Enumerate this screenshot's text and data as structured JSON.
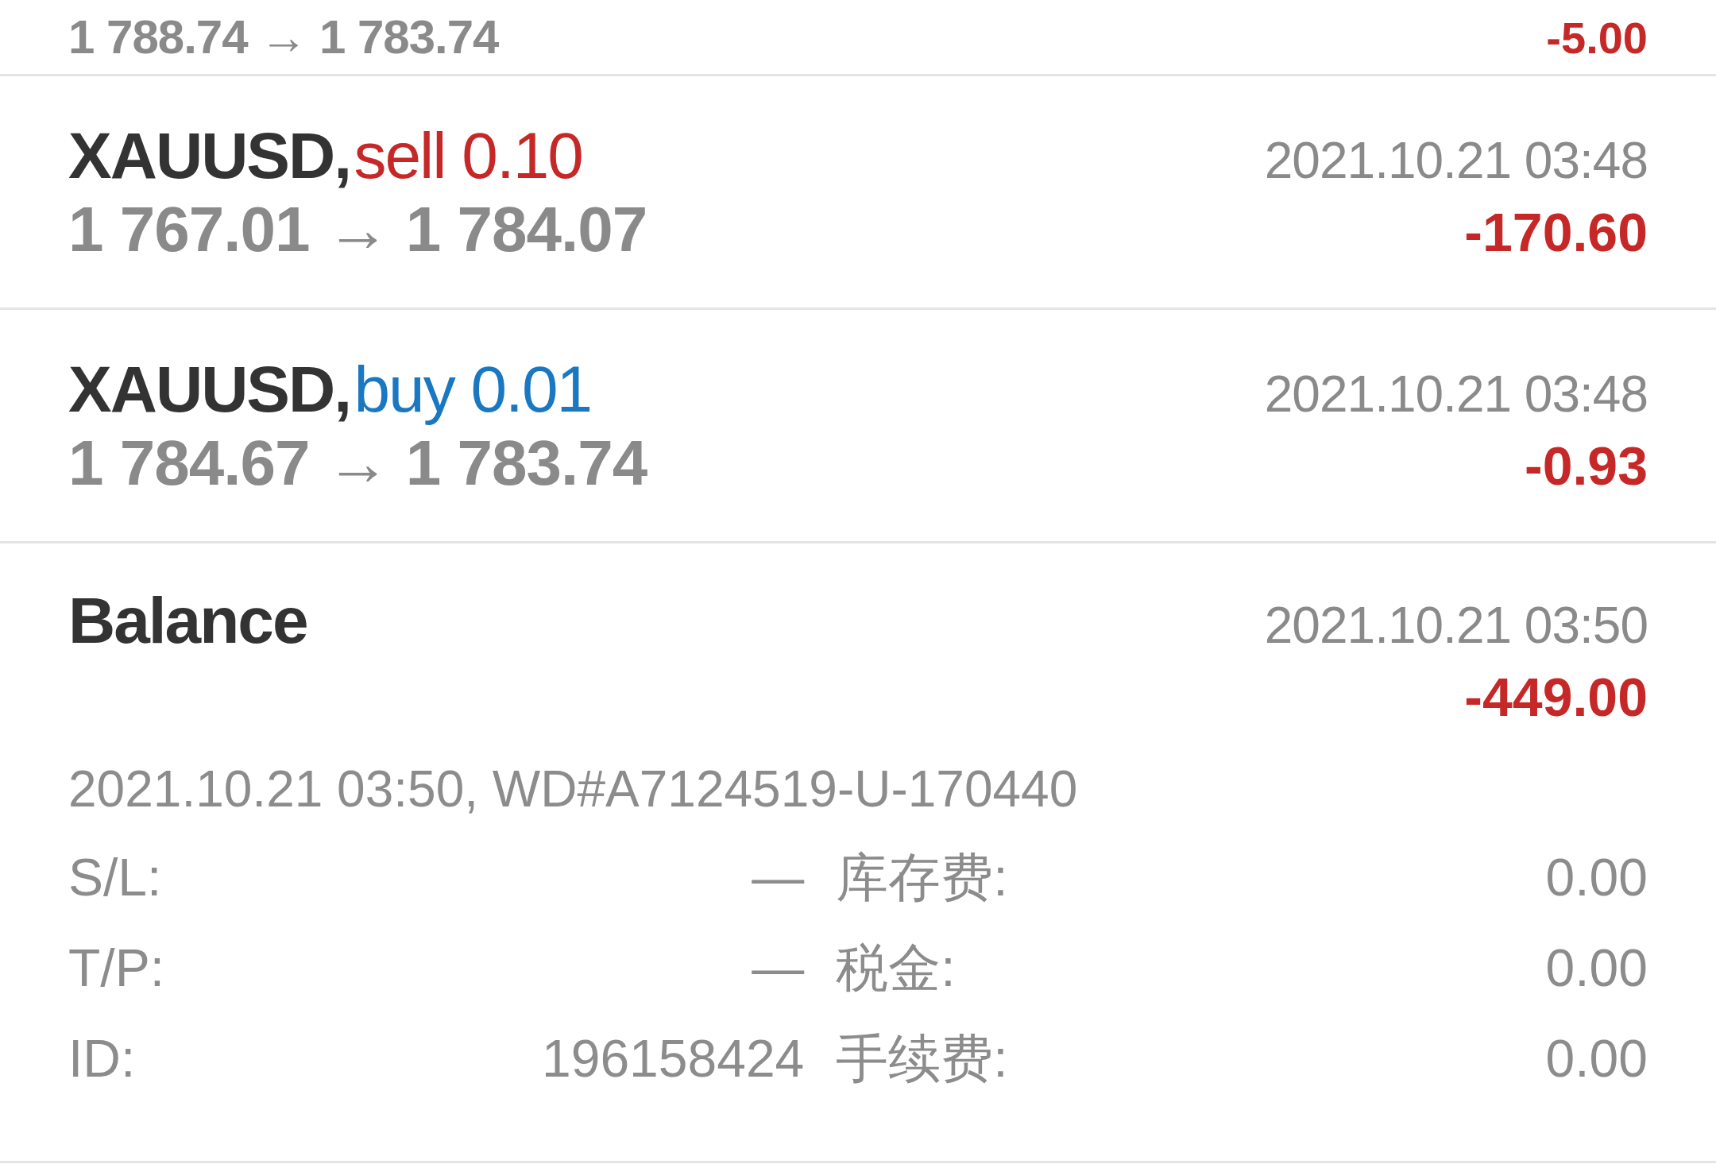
{
  "deals": [
    {
      "kind": "partial",
      "prices": "1 788.74 → 1 783.74",
      "profit": "-5.00"
    },
    {
      "kind": "trade",
      "symbol": "XAUUSD,",
      "side": "sell",
      "volume": "0.10",
      "time": "2021.10.21 03:48",
      "prices": "1 767.01 → 1 784.07",
      "profit": "-170.60"
    },
    {
      "kind": "trade",
      "symbol": "XAUUSD,",
      "side": "buy",
      "volume": "0.01",
      "time": "2021.10.21 03:48",
      "prices": "1 784.67 → 1 783.74",
      "profit": "-0.93"
    },
    {
      "kind": "balance",
      "title": "Balance",
      "time": "2021.10.21 03:50",
      "profit": "-449.00",
      "expanded": true,
      "comment": "2021.10.21 03:50, WD#A7124519-U-170440",
      "details": [
        {
          "label": "S/L:",
          "value": "—",
          "label_2": "库存费:",
          "value_2": "0.00"
        },
        {
          "label": "T/P:",
          "value": "—",
          "label_2": "税金:",
          "value_2": "0.00"
        },
        {
          "label": "ID:",
          "value": "196158424",
          "label_2": "手续费:",
          "value_2": "0.00"
        }
      ]
    }
  ]
}
